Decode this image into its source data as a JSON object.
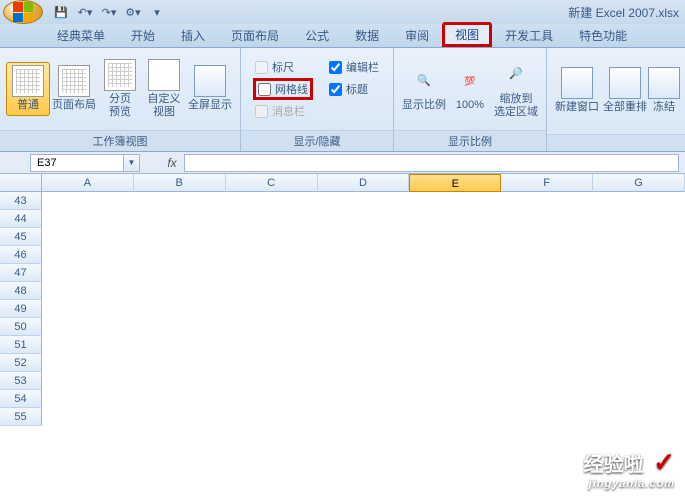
{
  "title": "新建 Excel 2007.xlsx",
  "tabs": {
    "classic": "经典菜单",
    "home": "开始",
    "insert": "插入",
    "layout": "页面布局",
    "formula": "公式",
    "data": "数据",
    "review": "审阅",
    "view": "视图",
    "dev": "开发工具",
    "special": "特色功能"
  },
  "ribbon": {
    "views": {
      "normal": "普通",
      "pagelayout": "页面布局",
      "pagebreak": "分页\n预览",
      "custom": "自定义\n视图",
      "fullscreen": "全屏显示",
      "group": "工作簿视图"
    },
    "show": {
      "ruler": "标尺",
      "formulabar": "编辑栏",
      "gridlines": "网格线",
      "headings": "标题",
      "messagebar": "消息栏",
      "group": "显示/隐藏"
    },
    "zoom": {
      "zoom": "显示比例",
      "hundred": "100%",
      "selection": "缩放到\n选定区域",
      "group": "显示比例"
    },
    "window": {
      "newwin": "新建窗口",
      "arrange": "全部重排",
      "freeze": "冻结"
    }
  },
  "namebox": "E37",
  "columns": [
    "A",
    "B",
    "C",
    "D",
    "E",
    "F",
    "G"
  ],
  "rows": [
    "43",
    "44",
    "45",
    "46",
    "47",
    "48",
    "49",
    "50",
    "51",
    "52",
    "53",
    "54",
    "55"
  ],
  "watermark": {
    "text": "经验啦",
    "check": "✓",
    "url": "jingyanla.com"
  }
}
